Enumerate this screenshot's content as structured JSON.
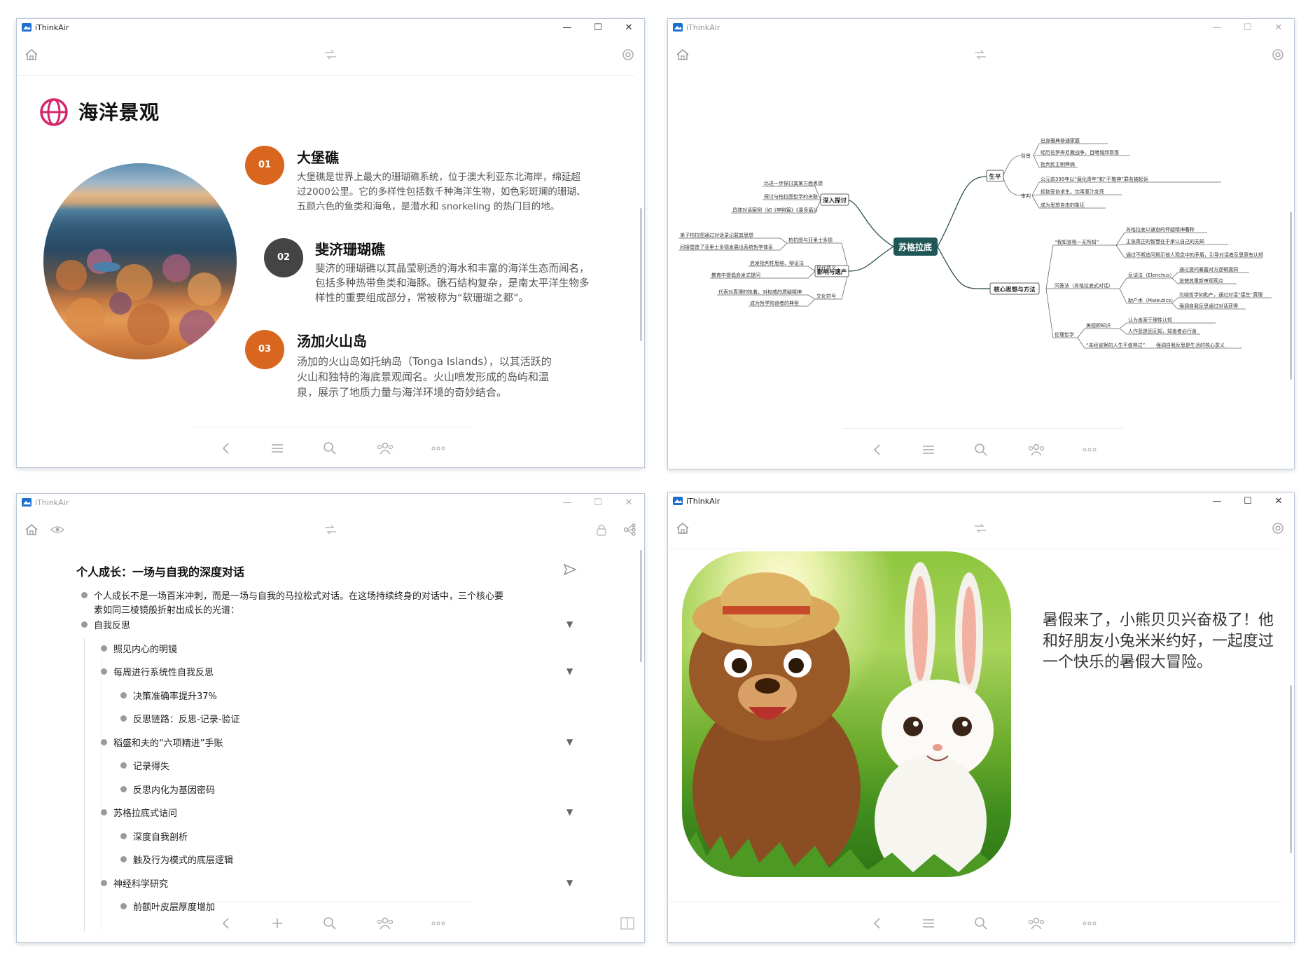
{
  "app": {
    "title": "iThinkAir",
    "brand_color": "#1a6fd0"
  },
  "window1": {
    "slide_title": "海洋景观",
    "accent_orange": "#d9661e",
    "accent_dark": "#444444",
    "items": [
      {
        "num": "01",
        "title": "大堡礁",
        "lines": [
          "大堡礁是世界上最大的珊瑚礁系统，位于澳大利亚东北海岸，绵延超",
          "过2000公里。它的多样性包括数千种海洋生物，如色彩斑斓的珊瑚、",
          "五颜六色的鱼类和海龟，是潜水和 snorkeling 的热门目的地。"
        ]
      },
      {
        "num": "02",
        "title": "斐济珊瑚礁",
        "lines": [
          "斐济的珊瑚礁以其晶莹剔透的海水和丰富的海洋生态而闻名，",
          "包括多种热带鱼类和海豚。礁石结构复杂，是南太平洋生物多",
          "样性的重要组成部分，常被称为“软珊瑚之都”。"
        ]
      },
      {
        "num": "03",
        "title": "汤加火山岛",
        "lines": [
          "汤加的火山岛如托纳岛（Tonga Islands），以其活跃的",
          "火山和独特的海底景观闻名。火山喷发形成的岛屿和温",
          "泉，展示了地质力量与海洋环境的奇妙结合。"
        ]
      }
    ]
  },
  "window2": {
    "center": "苏格拉底",
    "branches": {
      "shengping": "生平",
      "beijing": "背景",
      "bj1": "出身雅典普通家庭",
      "bj2": "经历伯罗奔尼撒战争，目睹城邦衰落",
      "bj3": "批判民主制弊病",
      "shenpan": "审判",
      "sp1": "公元前399年以“腐化青年”和“不敬神”罪名被起诉",
      "sp2": "拒绝妥协求生，饮毒堇汁赴死",
      "sp3": "成为思想自由的象征",
      "shenru": "深入探讨",
      "sr1": "比进一步探讨其某方面思想",
      "sr2": "探讨与柏拉图哲学的关联",
      "sr3": "具体对话案例（如《申辩篇》《斐多篇》）",
      "yingxiang": "影响与遗产",
      "yx_a": "柏拉图与亚里士多德",
      "yx_a1": "弟子柏拉图通过对话录记载其思想",
      "yx_a2": "间接塑造了亚里士多德发展出系统哲学体系",
      "yx_b": "现代意义",
      "yx_b1": "启发批判性思维、辩证法",
      "yx_b2": "教育中提倡启发式提问",
      "yx_c": "文化符号",
      "yx_c1": "代表对真理的执着，对权威的质疑精神",
      "yx_c2": "成为哲学殉道者的典型",
      "hexin": "核心思想与方法",
      "hx_a": "“我知道我一无所知”",
      "hx_a1": "苏格拉底以谦逊的怀疑精神著称",
      "hx_a2": "主张真正的智慧在于承认自己的无知",
      "hx_a3": "通过不断追问揭示他人观念中的矛盾，引导对话者反思原有认知",
      "hx_b": "问答法（苏格拉底式对话）",
      "hx_b1": "反诘法（Elenchus）",
      "hx_b1a": "通过提问暴露对方逻辑漏洞",
      "hx_b1b": "迫使其重新审视观点",
      "hx_b2": "助产术（Maieutics）",
      "hx_b2a": "比喻哲学如助产，通过对话“接生”真理",
      "hx_b2b": "强调自我反思通过对话获得",
      "hx_c": "伦理哲学",
      "hx_c1": "美德即知识",
      "hx_c1a": "认为善源于理性认知",
      "hx_c1b": "人作恶是因无知，知善者必行善",
      "hx_c2": "“未经省察的人生不值得过”",
      "hx_c2a": "强调自我反思是生活的核心意义"
    }
  },
  "window3": {
    "title": "个人成长：一场与自我的深度对话",
    "intro": [
      "个人成长不是一场百米冲刺，而是一场与自我的马拉松式对话。在这场持续终身的对话中，三个核心要",
      "素如同三棱镜般折射出成长的光谱："
    ],
    "rows": [
      {
        "text": "自我反思",
        "level": 0,
        "fold": true
      },
      {
        "text": "照见内心的明镜",
        "level": 1,
        "fold": false
      },
      {
        "text": "每周进行系统性自我反思",
        "level": 1,
        "fold": true
      },
      {
        "text": "决策准确率提升37%",
        "level": 2,
        "fold": false
      },
      {
        "text": "反思链路：反思-记录-验证",
        "level": 2,
        "fold": false
      },
      {
        "text": "稻盛和夫的“六项精进”手账",
        "level": 1,
        "fold": true
      },
      {
        "text": "记录得失",
        "level": 2,
        "fold": false
      },
      {
        "text": "反思内化为基因密码",
        "level": 2,
        "fold": false
      },
      {
        "text": "苏格拉底式诘问",
        "level": 1,
        "fold": true
      },
      {
        "text": "深度自我剖析",
        "level": 2,
        "fold": false
      },
      {
        "text": "触及行为模式的底层逻辑",
        "level": 2,
        "fold": false
      },
      {
        "text": "神经科学研究",
        "level": 1,
        "fold": true
      },
      {
        "text": "前额叶皮层厚度增加",
        "level": 2,
        "fold": false
      }
    ],
    "fold_glyph": "▼"
  },
  "window4": {
    "story": "暑假来了，小熊贝贝兴奋极了！他和好朋友小兔米米约好，一起度过一个快乐的暑假大冒险。"
  }
}
